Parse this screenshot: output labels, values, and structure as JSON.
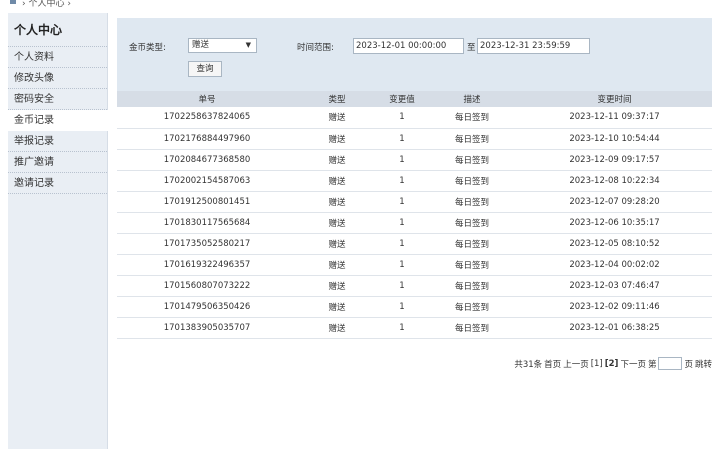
{
  "breadcrumb": {
    "text": "› 个人中心 ›"
  },
  "sidebar": {
    "title": "个人中心",
    "items": [
      {
        "label": "个人资料",
        "active": false
      },
      {
        "label": "修改头像",
        "active": false
      },
      {
        "label": "密码安全",
        "active": false
      },
      {
        "label": "金币记录",
        "active": true
      },
      {
        "label": "举报记录",
        "active": false
      },
      {
        "label": "推广邀请",
        "active": false
      },
      {
        "label": "邀请记录",
        "active": false
      }
    ]
  },
  "filter": {
    "type_label": "金币类型:",
    "type_value": "赠送",
    "time_label": "时间范围:",
    "start_time": "2023-12-01 00:00:00",
    "to_label": "至",
    "end_time": "2023-12-31 23:59:59",
    "query_button": "查询"
  },
  "table": {
    "headers": [
      "单号",
      "类型",
      "变更值",
      "描述",
      "变更时间"
    ],
    "rows": [
      [
        "1702258637824065",
        "赠送",
        "1",
        "每日签到",
        "2023-12-11 09:37:17"
      ],
      [
        "1702176884497960",
        "赠送",
        "1",
        "每日签到",
        "2023-12-10 10:54:44"
      ],
      [
        "1702084677368580",
        "赠送",
        "1",
        "每日签到",
        "2023-12-09 09:17:57"
      ],
      [
        "1702002154587063",
        "赠送",
        "1",
        "每日签到",
        "2023-12-08 10:22:34"
      ],
      [
        "1701912500801451",
        "赠送",
        "1",
        "每日签到",
        "2023-12-07 09:28:20"
      ],
      [
        "1701830117565684",
        "赠送",
        "1",
        "每日签到",
        "2023-12-06 10:35:17"
      ],
      [
        "1701735052580217",
        "赠送",
        "1",
        "每日签到",
        "2023-12-05 08:10:52"
      ],
      [
        "1701619322496357",
        "赠送",
        "1",
        "每日签到",
        "2023-12-04 00:02:02"
      ],
      [
        "1701560807073222",
        "赠送",
        "1",
        "每日签到",
        "2023-12-03 07:46:47"
      ],
      [
        "1701479506350426",
        "赠送",
        "1",
        "每日签到",
        "2023-12-02 09:11:46"
      ],
      [
        "1701383905035707",
        "赠送",
        "1",
        "每日签到",
        "2023-12-01 06:38:25"
      ]
    ]
  },
  "pager": {
    "total": "共31条",
    "first": "首页",
    "prev": "上一页",
    "page1": "[1]",
    "page2": "[2]",
    "next": "下一页",
    "goto_prefix": "第",
    "goto_suffix": "页",
    "jump": "跳转"
  },
  "icons": {
    "home": "home-icon",
    "dropdown": "dropdown-arrow-icon"
  },
  "colors": {
    "sidebar_bg": "#e9eef4",
    "filter_bg": "#dfe8f1",
    "header_bg": "#d6dde6"
  }
}
